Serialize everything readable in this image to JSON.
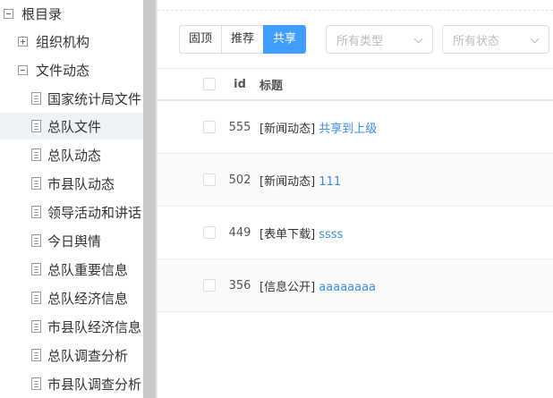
{
  "tree": {
    "root": "根目录",
    "org": "组织机构",
    "docs": "文件动态",
    "children": [
      "国家统计局文件",
      "总队文件",
      "总队动态",
      "市县队动态",
      "领导活动和讲话",
      "今日舆情",
      "总队重要信息",
      "总队经济信息",
      "市县队经济信息",
      "总队调查分析",
      "市县队调查分析"
    ]
  },
  "toolbar": {
    "btn_pin": "固顶",
    "btn_recommend": "推荐",
    "btn_share": "共享",
    "type_placeholder": "所有类型",
    "status_placeholder": "所有状态"
  },
  "table": {
    "col_id": "id",
    "col_title": "标题",
    "rows": [
      {
        "id": "555",
        "category": "[新闻动态]",
        "title": "共享到上级"
      },
      {
        "id": "502",
        "category": "[新闻动态]",
        "title": "111"
      },
      {
        "id": "449",
        "category": "[表单下载]",
        "title": "ssss"
      },
      {
        "id": "356",
        "category": "[信息公开]",
        "title": "aaaaaaaa"
      }
    ]
  },
  "colors": {
    "accent": "#409eff",
    "link": "#3a8ee6",
    "selected_bg": "#eef1f6",
    "scrollbar": "#c9c9c9"
  }
}
